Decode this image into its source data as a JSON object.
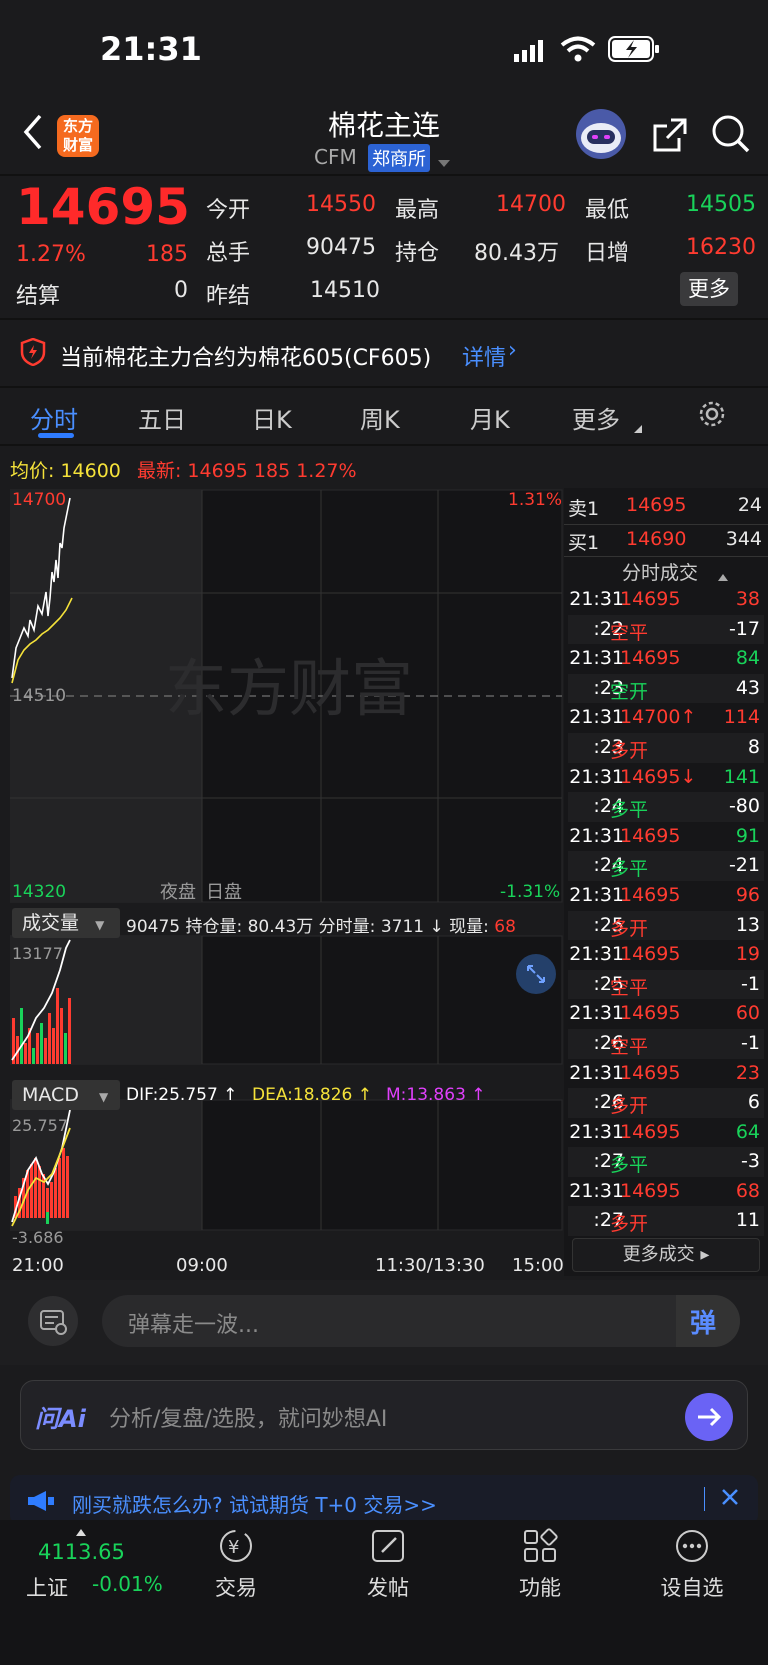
{
  "status": {
    "time": "21:31"
  },
  "header": {
    "title": "棉花主连",
    "code": "CFM",
    "exchange": "郑商所",
    "logo_text": "东方财富"
  },
  "quote": {
    "price": "14695",
    "change_pct": "1.27%",
    "change": "185",
    "settle_label": "结算",
    "settle_value": "0",
    "open_label": "今开",
    "open_value": "14550",
    "volume_label": "总手",
    "volume_value": "90475",
    "prev_settle_label": "昨结",
    "prev_settle_value": "14510",
    "high_label": "最高",
    "high_value": "14700",
    "oi_label": "持仓",
    "oi_value": "80.43万",
    "low_label": "最低",
    "low_value": "14505",
    "daily_inc_label": "日增",
    "daily_inc_value": "16230",
    "more_label": "更多"
  },
  "notice": {
    "text": "当前棉花主力合约为棉花605(CF605)",
    "link": "详情"
  },
  "tabs": [
    "分时",
    "五日",
    "日K",
    "周K",
    "月K",
    "更多"
  ],
  "summary": {
    "avg_label": "均价:",
    "avg_value": "14600",
    "latest_label": "最新:",
    "latest_value": "14695",
    "latest_change": "185",
    "latest_pct": "1.27%"
  },
  "chart": {
    "top_price": "14700",
    "top_pct": "1.31%",
    "mid_price": "14510",
    "bottom_price": "14320",
    "bottom_pct": "-1.31%",
    "night_label": "夜盘",
    "day_label": "日盘",
    "watermark": "东方财富",
    "vol_label": "成交量",
    "vol_text": "90475 持仓量: 80.43万 分时量: 3711 ↓ 现量:",
    "vol_now": "68",
    "vol_max": "13177",
    "macd_label": "MACD",
    "dif": "DIF:25.757 ↑",
    "dea": "DEA:18.826 ↑",
    "m": "M:13.863 ↑",
    "macd_top": "25.757",
    "macd_bottom": "-3.686",
    "times": [
      "21:00",
      "09:00",
      "11:30/13:30",
      "15:00"
    ],
    "colors": {
      "price_line": "#ffffff",
      "avg_line": "#f5e23a",
      "up": "#ff3b30",
      "down": "#19d35a"
    }
  },
  "orderbook": {
    "ask_label": "卖1",
    "ask_price": "14695",
    "ask_vol": "24",
    "bid_label": "买1",
    "bid_price": "14690",
    "bid_vol": "344",
    "trades_title": "分时成交",
    "trades": [
      {
        "t": "21:31",
        "p": "14695",
        "v": "38",
        "pc": "red",
        "vc": "red"
      },
      {
        "t": ":22",
        "p": "空平",
        "v": "-17",
        "pc": "red",
        "vc": "white"
      },
      {
        "t": "21:31",
        "p": "14695",
        "v": "84",
        "pc": "red",
        "vc": "green"
      },
      {
        "t": ":23",
        "p": "空开",
        "v": "43",
        "pc": "green",
        "vc": "white"
      },
      {
        "t": "21:31",
        "p": "14700↑",
        "v": "114",
        "pc": "red",
        "vc": "red"
      },
      {
        "t": ":23",
        "p": "多开",
        "v": "8",
        "pc": "red",
        "vc": "white"
      },
      {
        "t": "21:31",
        "p": "14695↓",
        "v": "141",
        "pc": "red",
        "vc": "green"
      },
      {
        "t": ":24",
        "p": "多平",
        "v": "-80",
        "pc": "green",
        "vc": "white"
      },
      {
        "t": "21:31",
        "p": "14695",
        "v": "91",
        "pc": "red",
        "vc": "green"
      },
      {
        "t": ":24",
        "p": "多平",
        "v": "-21",
        "pc": "green",
        "vc": "white"
      },
      {
        "t": "21:31",
        "p": "14695",
        "v": "96",
        "pc": "red",
        "vc": "red"
      },
      {
        "t": ":25",
        "p": "多开",
        "v": "13",
        "pc": "red",
        "vc": "white"
      },
      {
        "t": "21:31",
        "p": "14695",
        "v": "19",
        "pc": "red",
        "vc": "red"
      },
      {
        "t": ":25",
        "p": "空平",
        "v": "-1",
        "pc": "red",
        "vc": "white"
      },
      {
        "t": "21:31",
        "p": "14695",
        "v": "60",
        "pc": "red",
        "vc": "red"
      },
      {
        "t": ":26",
        "p": "空平",
        "v": "-1",
        "pc": "red",
        "vc": "white"
      },
      {
        "t": "21:31",
        "p": "14695",
        "v": "23",
        "pc": "red",
        "vc": "red"
      },
      {
        "t": ":26",
        "p": "多开",
        "v": "6",
        "pc": "red",
        "vc": "white"
      },
      {
        "t": "21:31",
        "p": "14695",
        "v": "64",
        "pc": "red",
        "vc": "green"
      },
      {
        "t": ":27",
        "p": "多平",
        "v": "-3",
        "pc": "green",
        "vc": "white"
      },
      {
        "t": "21:31",
        "p": "14695",
        "v": "68",
        "pc": "red",
        "vc": "red"
      },
      {
        "t": ":27",
        "p": "多开",
        "v": "11",
        "pc": "red",
        "vc": "white"
      }
    ],
    "more_trades": "更多成交"
  },
  "comment": {
    "placeholder": "弹幕走一波...",
    "danmu": "弹"
  },
  "ai": {
    "logo": "问Ai",
    "placeholder": "分析/复盘/选股，就问妙想AI"
  },
  "promo": {
    "text": "刚买就跌怎么办? 试试期货 T+0 交易>>"
  },
  "bottom_nav": {
    "index_value": "4113.65",
    "index_name": "上证",
    "index_pct": "-0.01%",
    "items": [
      "交易",
      "发帖",
      "功能",
      "设自选"
    ]
  }
}
